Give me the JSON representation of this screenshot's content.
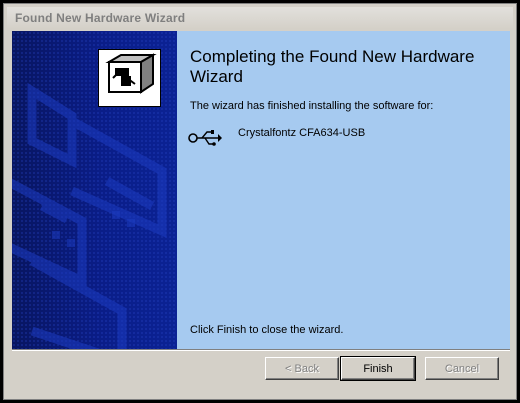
{
  "window": {
    "title": "Found New Hardware Wizard"
  },
  "main": {
    "heading": "Completing the Found New Hardware Wizard",
    "finished_text": "The wizard has finished installing the software for:",
    "device_name": "Crystalfontz CFA634-USB",
    "device_icon": "usb-icon",
    "close_instruction": "Click Finish to close the wizard."
  },
  "buttons": {
    "back_label": "< Back",
    "finish_label": "Finish",
    "cancel_label": "Cancel"
  },
  "colors": {
    "side_panel": "#0b1e80",
    "content_bg": "#a6caf0",
    "dialog_bg": "#d4d0c8"
  }
}
